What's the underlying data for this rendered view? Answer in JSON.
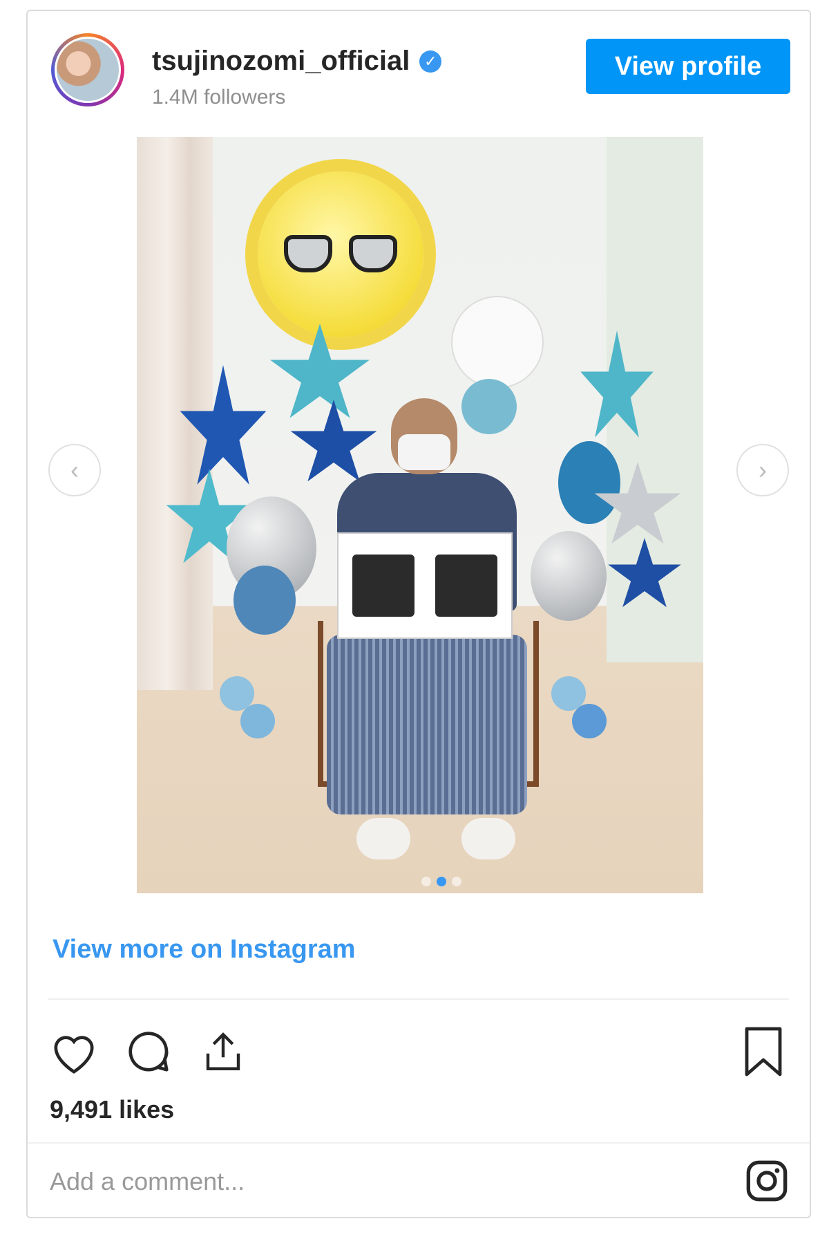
{
  "header": {
    "username": "tsujinozomi_official",
    "verified_icon": "verified-check-icon",
    "followers": "1.4M followers",
    "view_profile_label": "View profile"
  },
  "post": {
    "carousel": {
      "total_slides": 3,
      "active_slide": 2
    },
    "view_more_label": "View more on Instagram",
    "likes": "9,491 likes",
    "comment_placeholder": "Add a comment..."
  },
  "colors": {
    "accent": "#0095f6",
    "link": "#3897f0",
    "text": "#262626",
    "muted": "#8e8e8e",
    "border": "#dbdbdb"
  },
  "icons": {
    "like": "heart-icon",
    "comment": "comment-bubble-icon",
    "share": "share-icon",
    "save": "bookmark-icon",
    "brand": "instagram-logo-icon",
    "prev": "chevron-left-icon",
    "next": "chevron-right-icon"
  }
}
